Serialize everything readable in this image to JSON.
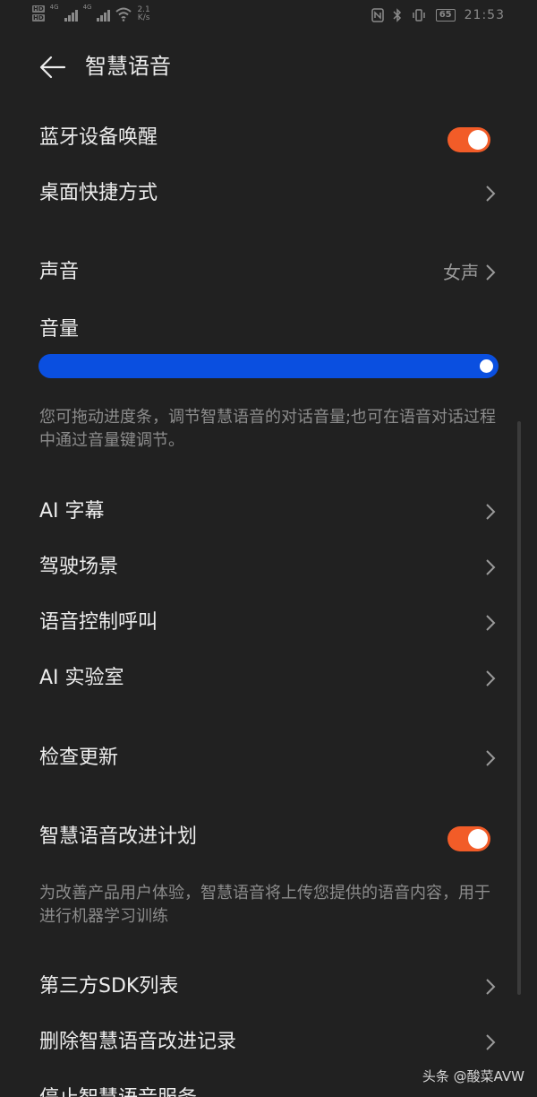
{
  "status_bar": {
    "hd1": "HD",
    "hd2": "HD",
    "sim1": "4G",
    "sim2": "4G",
    "speed_value": "2.1",
    "speed_unit": "K/s",
    "battery": "65",
    "time": "21:53"
  },
  "header": {
    "title": "智慧语音"
  },
  "settings": {
    "bt_wake": {
      "label": "蓝牙设备唤醒",
      "enabled": true
    },
    "shortcut": {
      "label": "桌面快捷方式"
    },
    "voice": {
      "label": "声音",
      "value": "女声"
    },
    "volume": {
      "label": "音量",
      "level": 1.0,
      "description": "您可拖动进度条，调节智慧语音的对话音量;也可在语音对话过程中通过音量键调节。"
    },
    "ai_caption": {
      "label": "AI 字幕"
    },
    "driving": {
      "label": "驾驶场景"
    },
    "voice_call": {
      "label": "语音控制呼叫"
    },
    "ai_lab": {
      "label": "AI 实验室"
    },
    "check_update": {
      "label": "检查更新"
    },
    "improve_plan": {
      "label": "智慧语音改进计划",
      "enabled": true,
      "description": "为改善产品用户体验，智慧语音将上传您提供的语音内容，用于进行机器学习训练"
    },
    "sdk_list": {
      "label": "第三方SDK列表"
    },
    "delete_records": {
      "label": "删除智慧语音改进记录"
    },
    "stop_service": {
      "label": "停止智慧语音服务"
    }
  },
  "watermark": "头条 @酸菜AVW",
  "colors": {
    "background": "#212121",
    "accent_toggle": "#f25c28",
    "slider": "#0a4fe0",
    "secondary_text": "#8c8c8c"
  }
}
